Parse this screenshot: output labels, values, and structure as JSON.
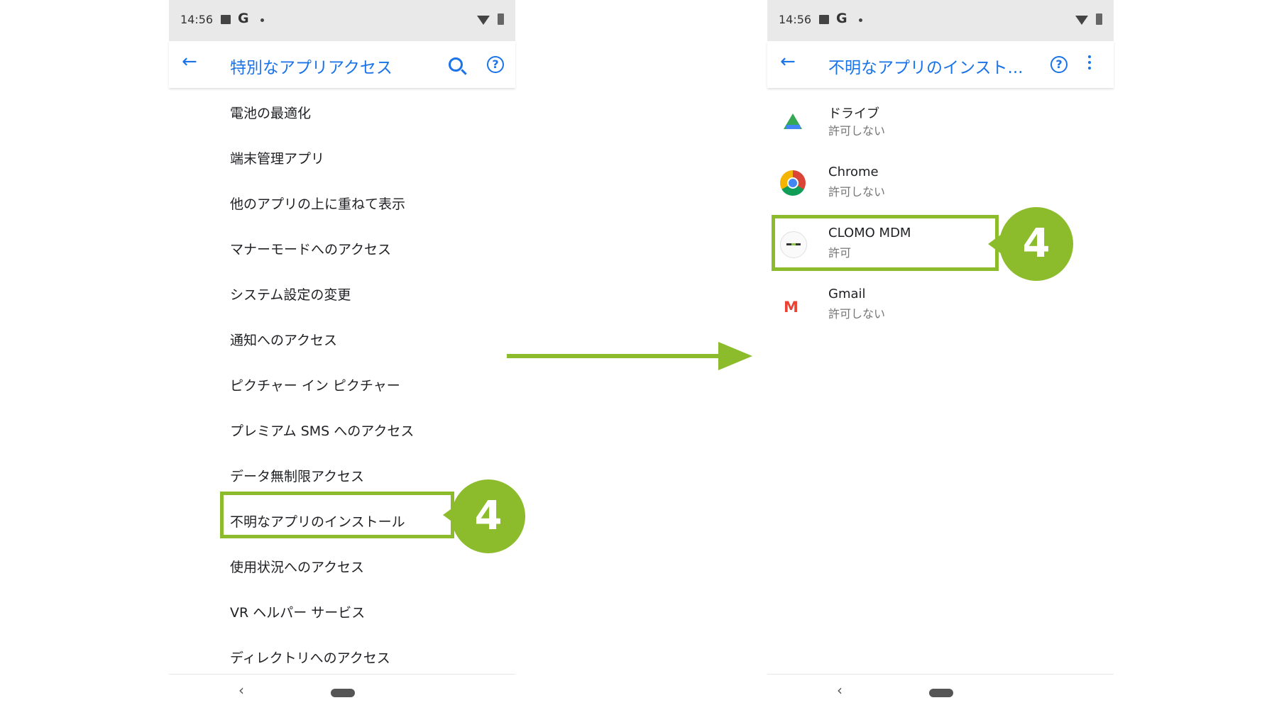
{
  "left_phone": {
    "status_bar": {
      "time": "14:56",
      "g_label": "G"
    },
    "app_bar": {
      "back_icon": "back-arrow-icon",
      "title": "特別なアプリアクセス",
      "search_icon": "search-icon",
      "help_icon": "help-icon"
    },
    "menu_items": [
      "電池の最適化",
      "端末管理アプリ",
      "他のアプリの上に重ねて表示",
      "マナーモードへのアクセス",
      "システム設定の変更",
      "通知へのアクセス",
      "ピクチャー イン ピクチャー",
      "プレミアム SMS へのアクセス",
      "データ無制限アクセス",
      "不明なアプリのインストール",
      "使用状況へのアクセス",
      "VR ヘルパー サービス",
      "ディレクトリへのアクセス"
    ],
    "step_marker": "4"
  },
  "right_phone": {
    "status_bar": {
      "time": "14:56",
      "g_label": "G"
    },
    "app_bar": {
      "back_icon": "back-arrow-icon",
      "title": "不明なアプリのインスト...",
      "help_icon": "help-icon",
      "more_icon": "more-vert-icon"
    },
    "apps": [
      {
        "name": "ドライブ",
        "status": "許可しない",
        "icon": "google-drive-icon"
      },
      {
        "name": "Chrome",
        "status": "許可しない",
        "icon": "chrome-icon"
      },
      {
        "name": "CLOMO MDM",
        "status": "許可",
        "icon": "clomo-mdm-icon"
      },
      {
        "name": "Gmail",
        "status": "許可しない",
        "icon": "gmail-icon"
      }
    ],
    "step_marker": "4"
  },
  "annotation": {
    "highlight_color": "#8cbc2b",
    "accent_color": "#1a73e8"
  }
}
